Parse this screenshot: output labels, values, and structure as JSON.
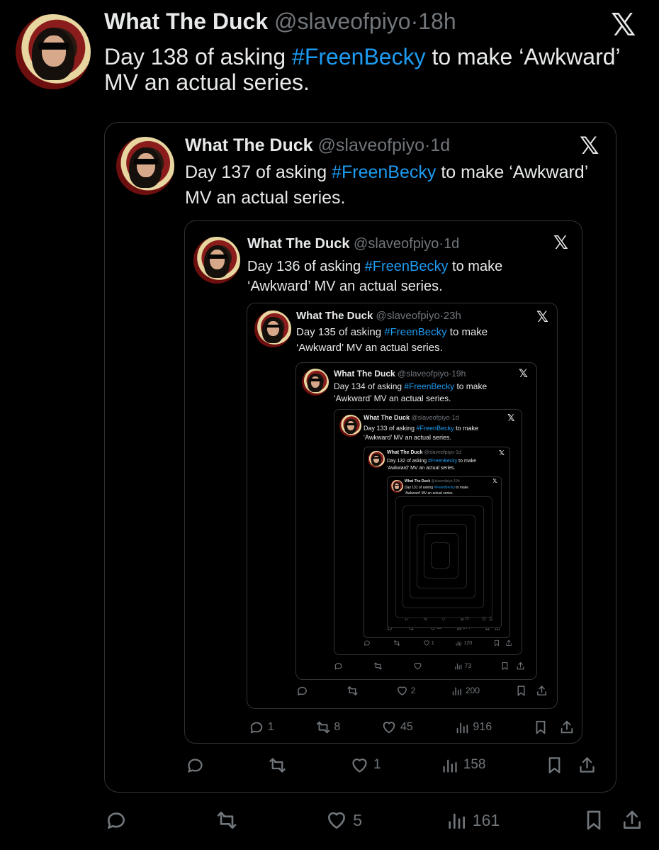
{
  "tweets": [
    {
      "name": "What The Duck",
      "handle": "@slaveofpiyo",
      "time": "18h",
      "text_before": "Day 138 of asking ",
      "hashtag": "#FreenBecky",
      "text_after": " to make ‘Awkward’ MV an actual series.",
      "replies": "",
      "reposts": "",
      "likes": "5",
      "views": "161"
    },
    {
      "name": "What The Duck",
      "handle": "@slaveofpiyo",
      "time": "1d",
      "text_before": "Day 137 of asking ",
      "hashtag": "#FreenBecky",
      "text_after": " to make ‘Awkward’ MV an actual series.",
      "replies": "",
      "reposts": "",
      "likes": "1",
      "views": "158"
    },
    {
      "name": "What The Duck",
      "handle": "@slaveofpiyo",
      "time": "1d",
      "text_before": "Day 136 of asking ",
      "hashtag": "#FreenBecky",
      "text_after": " to make ‘Awkward’ MV an actual series.",
      "replies": "1",
      "reposts": "8",
      "likes": "45",
      "views": "916"
    },
    {
      "name": "What The Duck",
      "handle": "@slaveofpiyo",
      "time": "23h",
      "text_before": "Day 135 of asking ",
      "hashtag": "#FreenBecky",
      "text_after": " to make ‘Awkward’ MV an actual series.",
      "replies": "",
      "reposts": "",
      "likes": "2",
      "views": "200"
    },
    {
      "name": "What The Duck",
      "handle": "@slaveofpiyo",
      "time": "19h",
      "text_before": "Day 134 of asking ",
      "hashtag": "#FreenBecky",
      "text_after": " to make ‘Awkward’ MV an actual series.",
      "replies": "",
      "reposts": "",
      "likes": "",
      "views": "73"
    },
    {
      "name": "What The Duck",
      "handle": "@slaveofpiyo",
      "time": "1d",
      "text_before": "Day 133 of asking ",
      "hashtag": "#FreenBecky",
      "text_after": " to make ‘Awkward’ MV an actual series.",
      "replies": "",
      "reposts": "",
      "likes": "1",
      "views": "120"
    },
    {
      "name": "What The Duck",
      "handle": "@slaveofpiyo",
      "time": "1d",
      "text_before": "Day 132 of asking ",
      "hashtag": "#FreenBecky",
      "text_after": " to make ‘Awkward’ MV an actual series.",
      "replies": "",
      "reposts": "",
      "likes": "16",
      "views": "274"
    },
    {
      "name": "What The Duck",
      "handle": "@slaveofpiyo",
      "time": "19h",
      "text_before": "Day 131 of asking ",
      "hashtag": "#FreenBecky",
      "text_after": " to make ‘Awkward’ MV an actual series.",
      "replies": "",
      "reposts": "",
      "likes": "",
      "views": "25"
    }
  ],
  "separator": "·",
  "logo": "𝕏",
  "icons": {
    "reply": "reply-icon",
    "repost": "repost-icon",
    "like": "heart-icon",
    "views": "views-icon",
    "bookmark": "bookmark-icon",
    "share": "share-icon",
    "logo": "x-logo-icon"
  },
  "colors": {
    "background": "#000000",
    "text": "#e7e9ea",
    "muted": "#71767b",
    "hashtag": "#1d9bf0",
    "border": "#2f3336"
  }
}
